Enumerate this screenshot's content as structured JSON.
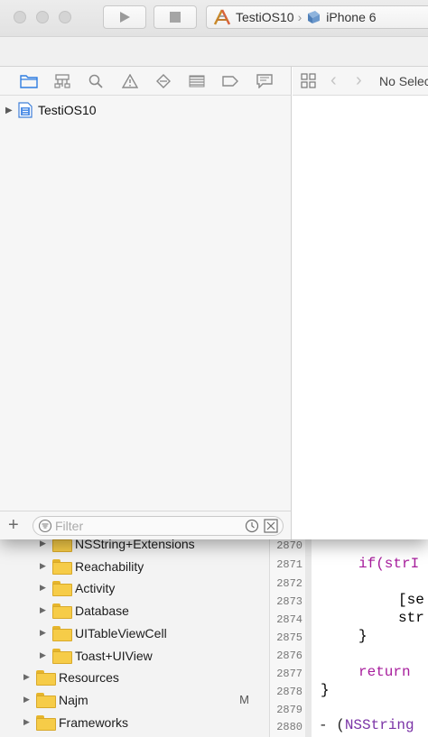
{
  "window": {
    "scheme": {
      "app_name": "TestiOS10",
      "device": "iPhone 6"
    }
  },
  "navigator": {
    "project_name": "TestiOS10",
    "filter_placeholder": "Filter"
  },
  "editor": {
    "jump_bar_text": "No Selection"
  },
  "background": {
    "file_tree": [
      {
        "label": "NSString+Extensions",
        "badge": ""
      },
      {
        "label": "Reachability",
        "badge": ""
      },
      {
        "label": "Activity",
        "badge": ""
      },
      {
        "label": "Database",
        "badge": ""
      },
      {
        "label": "UITableViewCell",
        "badge": ""
      },
      {
        "label": "Toast+UIView",
        "badge": ""
      },
      {
        "label": "Resources",
        "badge": ""
      },
      {
        "label": "Najm",
        "badge": "M"
      },
      {
        "label": "Frameworks",
        "badge": ""
      }
    ],
    "line_numbers": [
      "2870",
      "2871",
      "2872",
      "2873",
      "2874",
      "2875",
      "2876",
      "2877",
      "2878",
      "2879",
      "2880"
    ],
    "code": {
      "line1": "if(strI",
      "line2": "[se",
      "line3": "str",
      "line4": "}",
      "line5": "return",
      "line6": "}",
      "line7_prefix": "- (",
      "line7_class": "NSString"
    }
  }
}
